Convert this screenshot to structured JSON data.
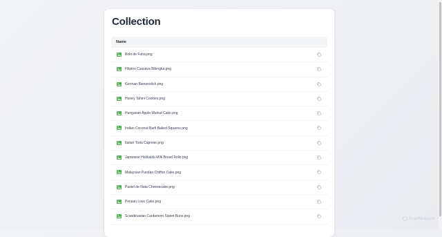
{
  "page": {
    "title": "Collection"
  },
  "table": {
    "header": "Name",
    "rows": [
      "Bolo de Fubá.png",
      "Filipino Cassava Bibingka.png",
      "German Bienenstich.png",
      "Honey Tahini Cookies.png",
      "Hungarian Apple Walnut Cake.png",
      "Indian Coconut Barfi Baked Squares.png",
      "Italian Torta Caprese.png",
      "Japanese Hokkaido Milk Bread Rolls.png",
      "Malaysian Pandan Chiffon Cake.png",
      "Pastel de Nata Cheesecake.png",
      "Persian Love Cake.png",
      "Scandinavian Cardamom Sweet Buns.png"
    ]
  },
  "icons": {
    "file": "image-file-icon",
    "action": "copy-icon"
  },
  "colors": {
    "accent": "#4caf50",
    "muted_icon": "#9ca3af"
  },
  "watermark": "ScanMalware"
}
